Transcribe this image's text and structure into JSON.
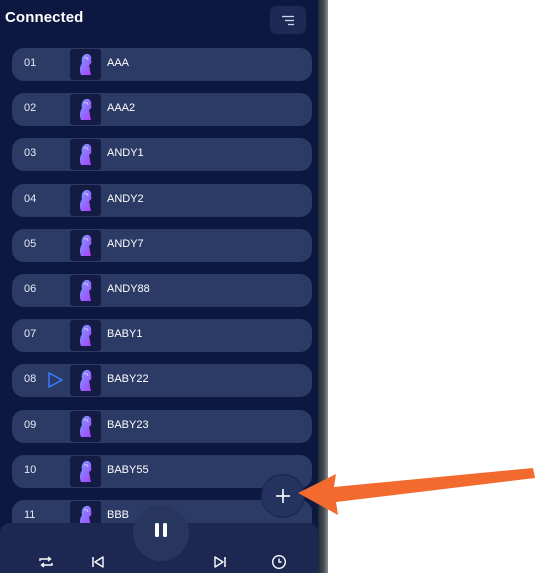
{
  "header": {
    "title": "Connected"
  },
  "playlist": [
    {
      "num": "01",
      "name": "AAA",
      "playing": false
    },
    {
      "num": "02",
      "name": "AAA2",
      "playing": false
    },
    {
      "num": "03",
      "name": "ANDY1",
      "playing": false
    },
    {
      "num": "04",
      "name": "ANDY2",
      "playing": false
    },
    {
      "num": "05",
      "name": "ANDY7",
      "playing": false
    },
    {
      "num": "06",
      "name": "ANDY88",
      "playing": false
    },
    {
      "num": "07",
      "name": "BABY1",
      "playing": false
    },
    {
      "num": "08",
      "name": "BABY22",
      "playing": true
    },
    {
      "num": "09",
      "name": "BABY23",
      "playing": false
    },
    {
      "num": "10",
      "name": "BABY55",
      "playing": false
    },
    {
      "num": "11",
      "name": "BBB",
      "playing": false
    }
  ],
  "icons": {
    "menu": "menu-lines-icon",
    "add": "plus-icon",
    "repeat": "repeat-icon",
    "previous": "skip-previous-icon",
    "pause": "pause-icon",
    "next": "skip-next-icon",
    "timer": "timer-icon",
    "now_playing": "play-triangle-icon"
  },
  "colors": {
    "background": "#0c1840",
    "row": "#2c3a66",
    "accent": "#3b7bff",
    "annotation_arrow": "#f26a2e"
  }
}
